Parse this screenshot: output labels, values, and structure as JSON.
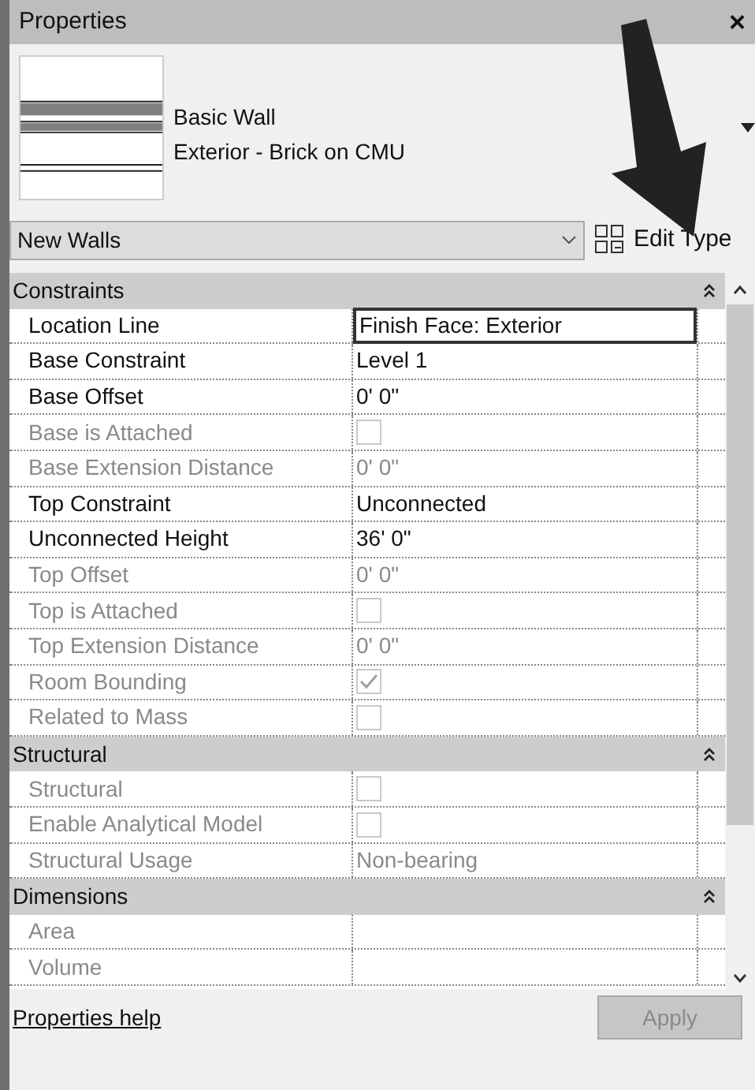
{
  "window": {
    "title": "Properties",
    "close": "×"
  },
  "type_selector": {
    "family": "Basic Wall",
    "type": "Exterior - Brick on CMU"
  },
  "instance_filter": {
    "value": "New Walls"
  },
  "edit_type": {
    "label": "Edit Type"
  },
  "sections": [
    {
      "title": "Constraints",
      "expanded": true,
      "rows": [
        {
          "label": "Location Line",
          "kind": "text",
          "value": "Finish Face: Exterior",
          "disabled": false,
          "selected": true
        },
        {
          "label": "Base Constraint",
          "kind": "text",
          "value": "Level 1",
          "disabled": false,
          "selected": false
        },
        {
          "label": "Base Offset",
          "kind": "text",
          "value": "0'  0\"",
          "disabled": false,
          "selected": false
        },
        {
          "label": "Base is Attached",
          "kind": "checkbox",
          "checked": false,
          "disabled": true,
          "selected": false
        },
        {
          "label": "Base Extension Distance",
          "kind": "text",
          "value": "0'  0\"",
          "disabled": true,
          "selected": false
        },
        {
          "label": "Top Constraint",
          "kind": "text",
          "value": "Unconnected",
          "disabled": false,
          "selected": false
        },
        {
          "label": "Unconnected Height",
          "kind": "text",
          "value": "36'  0\"",
          "disabled": false,
          "selected": false
        },
        {
          "label": "Top Offset",
          "kind": "text",
          "value": "0'  0\"",
          "disabled": true,
          "selected": false
        },
        {
          "label": "Top is Attached",
          "kind": "checkbox",
          "checked": false,
          "disabled": true,
          "selected": false
        },
        {
          "label": "Top Extension Distance",
          "kind": "text",
          "value": "0'  0\"",
          "disabled": true,
          "selected": false
        },
        {
          "label": "Room Bounding",
          "kind": "checkbox",
          "checked": true,
          "disabled": true,
          "selected": false
        },
        {
          "label": "Related to Mass",
          "kind": "checkbox",
          "checked": false,
          "disabled": true,
          "selected": false
        }
      ]
    },
    {
      "title": "Structural",
      "expanded": true,
      "rows": [
        {
          "label": "Structural",
          "kind": "checkbox",
          "checked": false,
          "disabled": true,
          "selected": false
        },
        {
          "label": "Enable Analytical Model",
          "kind": "checkbox",
          "checked": false,
          "disabled": true,
          "selected": false
        },
        {
          "label": "Structural Usage",
          "kind": "text",
          "value": "Non-bearing",
          "disabled": true,
          "selected": false
        }
      ]
    },
    {
      "title": "Dimensions",
      "expanded": true,
      "rows": [
        {
          "label": "Area",
          "kind": "empty",
          "disabled": true,
          "selected": false
        },
        {
          "label": "Volume",
          "kind": "empty",
          "disabled": true,
          "selected": false
        }
      ]
    }
  ],
  "footer": {
    "help_link": "Properties help",
    "apply": {
      "label": "Apply",
      "disabled": true
    }
  }
}
